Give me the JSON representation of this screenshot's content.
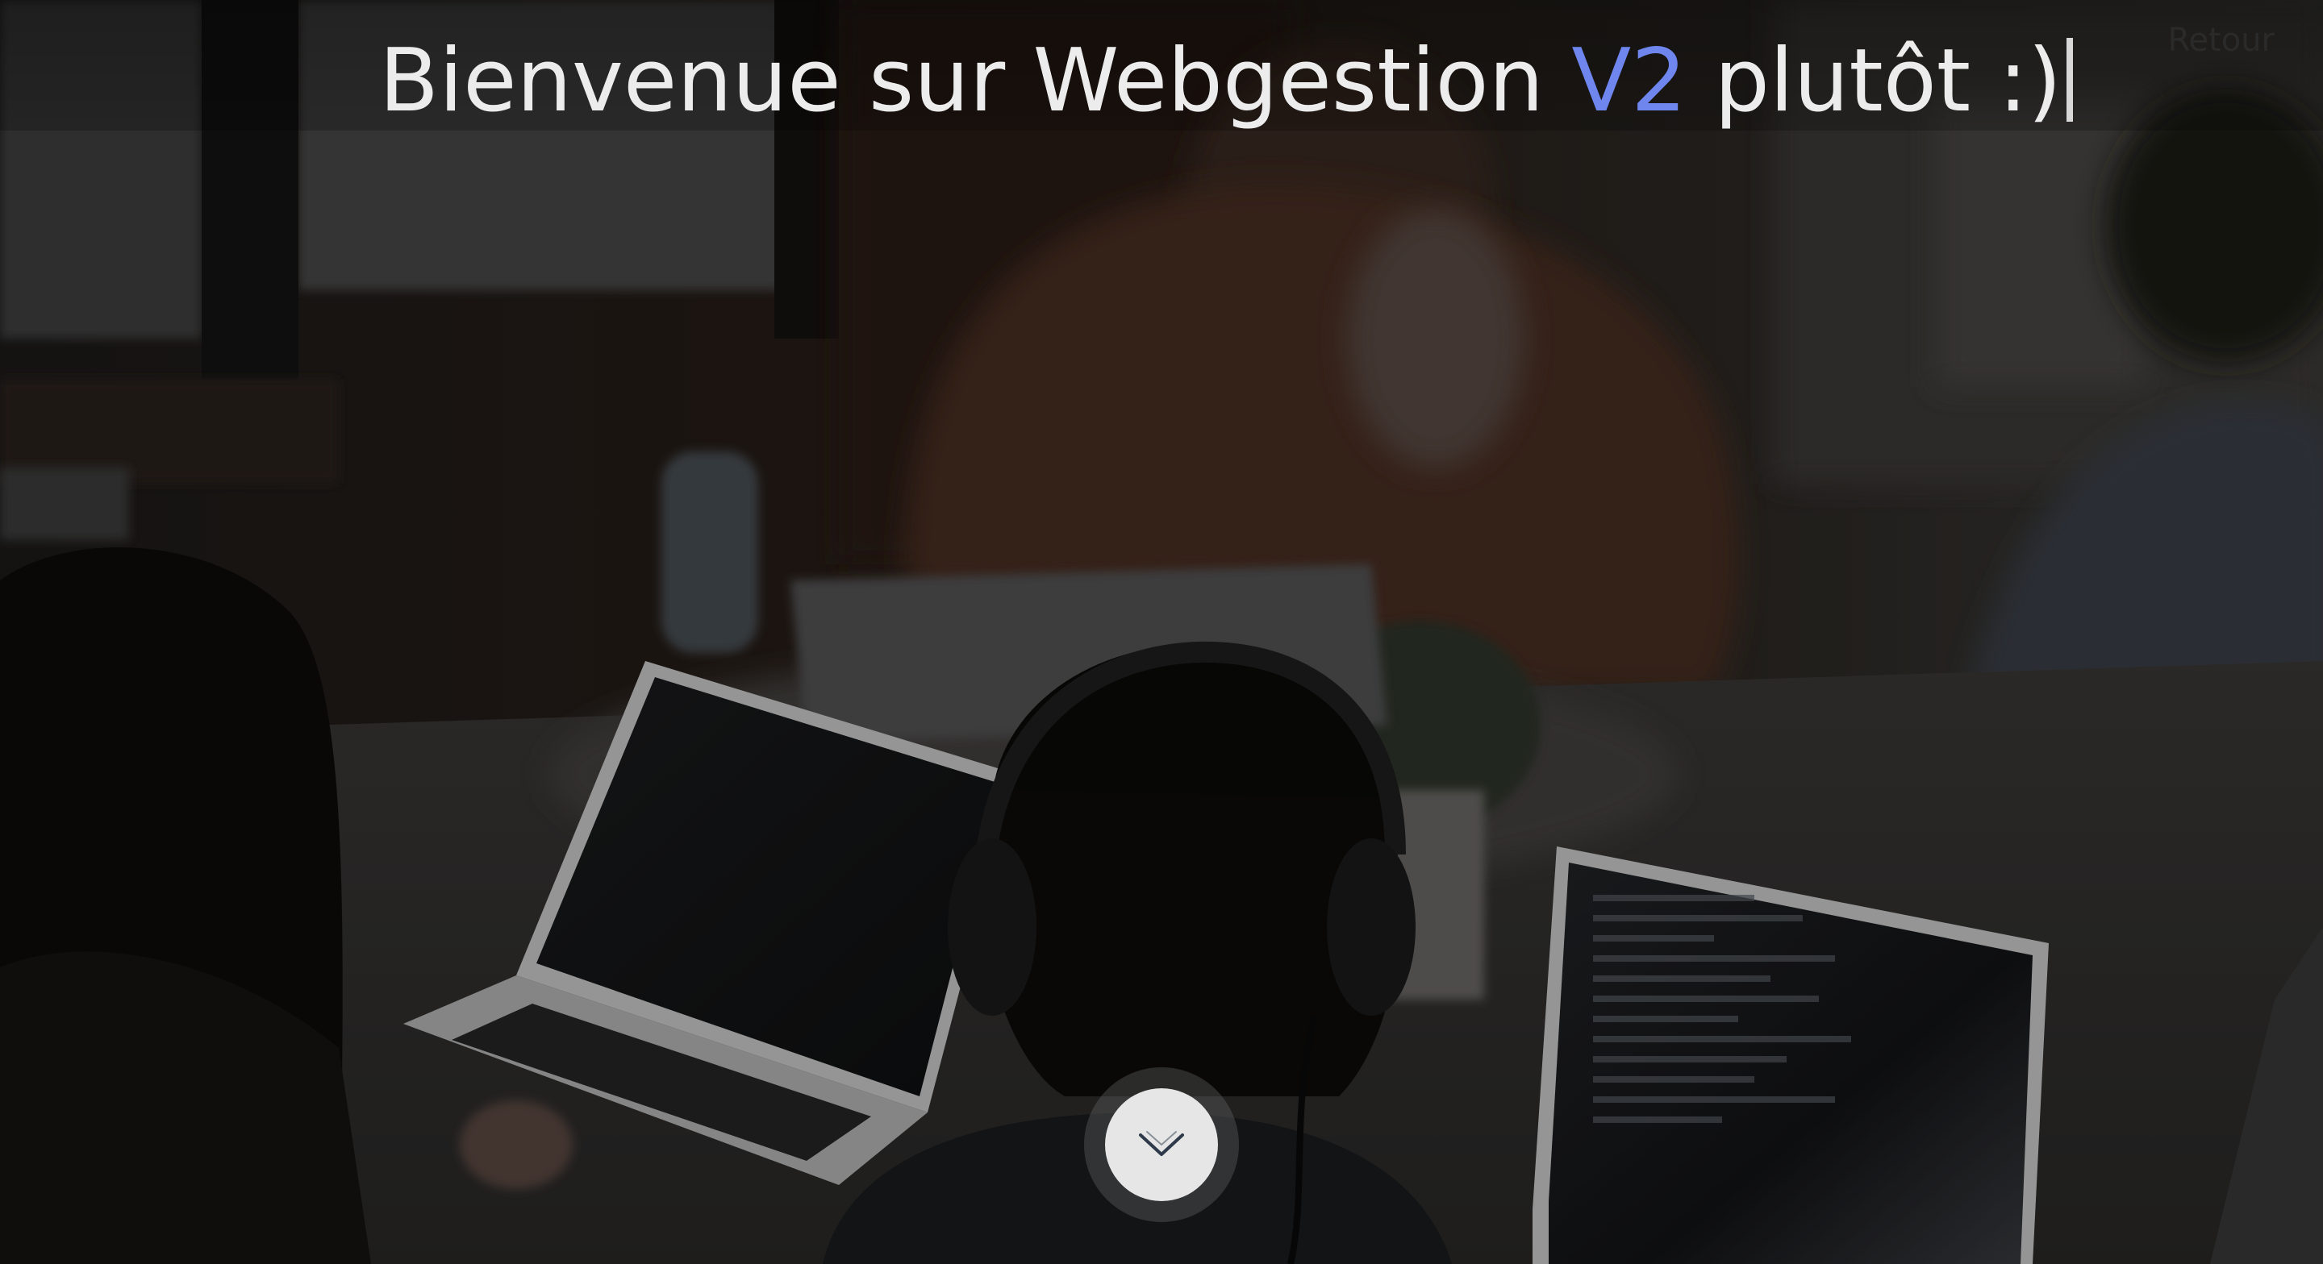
{
  "header": {
    "title_prefix": "Bienvenue sur Webgestion ",
    "title_accent": "V2",
    "title_suffix": " plutôt :)",
    "back_label": "Retour"
  },
  "hero": {
    "scroll_icon": "chevron-down-icon"
  },
  "colors": {
    "accent": "#6f86ee",
    "title_text": "#ececec",
    "scroll_button": "#e6e6e6"
  }
}
